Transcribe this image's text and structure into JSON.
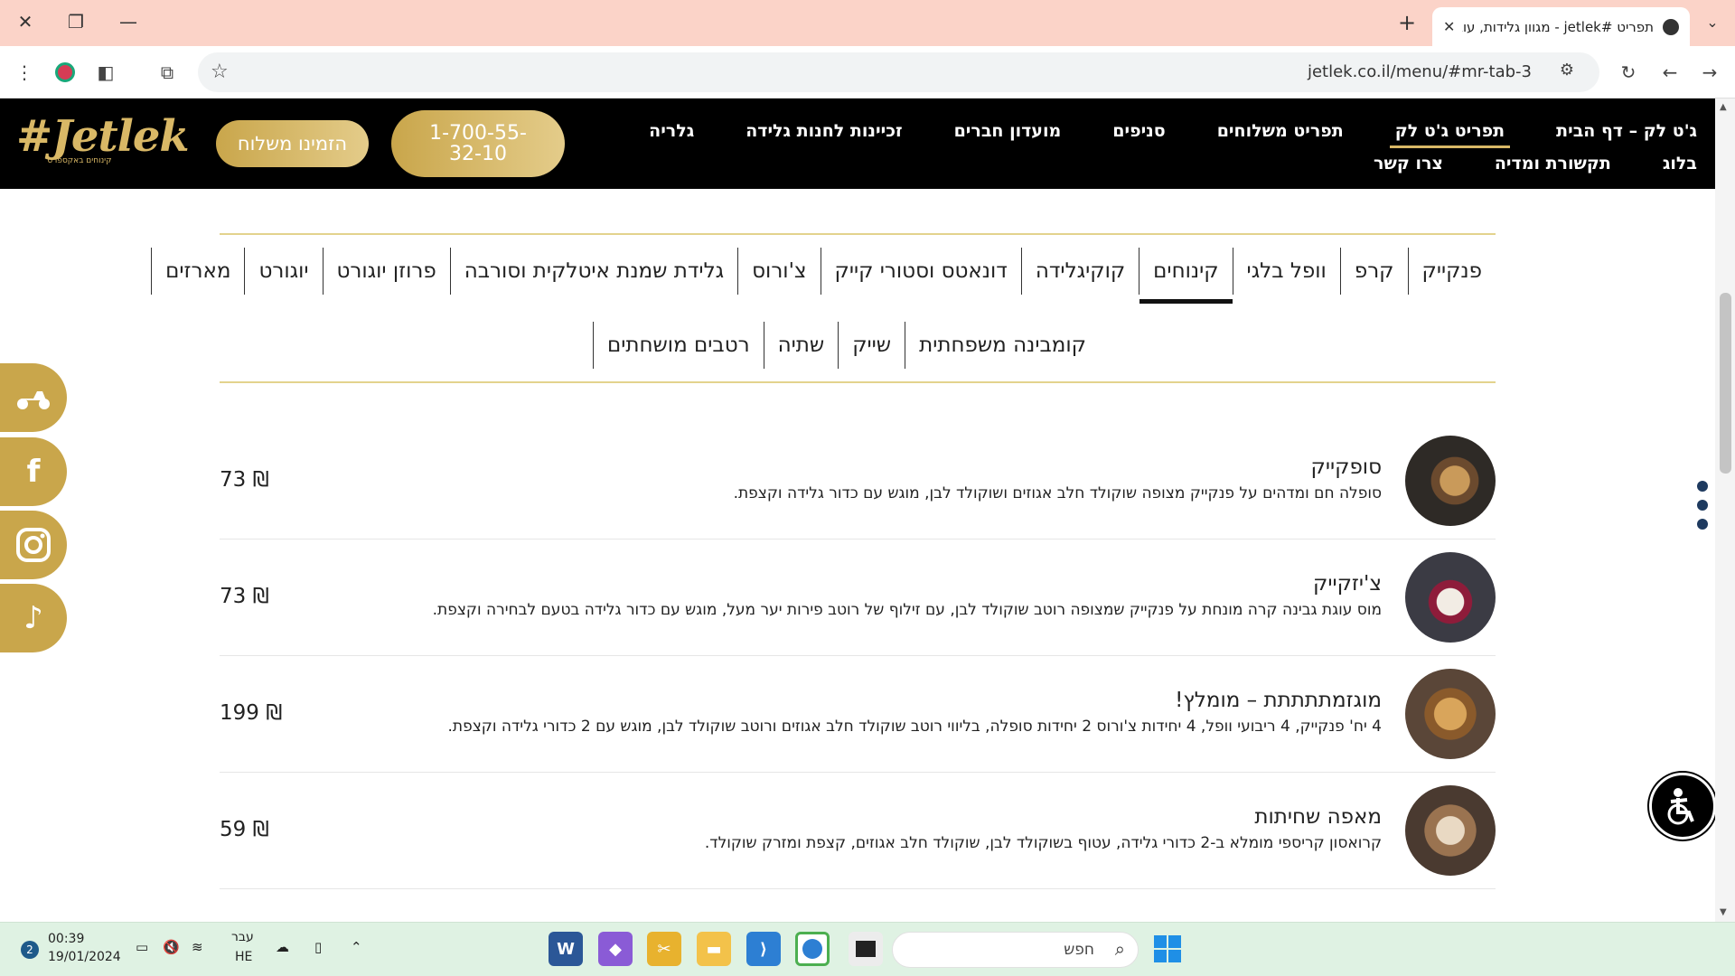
{
  "browser": {
    "tab_title": "תפריט #jetlek - מגוון גלידות, עוגות",
    "url": "jetlek.co.il/menu/#mr-tab-3"
  },
  "header": {
    "logo_text": "#Jetlek",
    "logo_sub": "קינוחים באקספרס",
    "order_button": "הזמינו משלוח",
    "phone_button": "1-700-55-32-10",
    "nav_row1": [
      "ג'ט לק – דף הבית",
      "תפריט ג'ט לק",
      "תפריט משלוחים",
      "סניפים",
      "מועדון חברים",
      "זכיינות לחנות גלידה",
      "גלריה"
    ],
    "nav_row2": [
      "בלוג",
      "תקשורת ומדיה",
      "צרו קשר"
    ]
  },
  "categories": {
    "row1": [
      "פנקייק",
      "קרפ",
      "וופל בלגי",
      "קינוחים",
      "קוקיגלידה",
      "דונאטס וסטורי קייק",
      "צ'ורוס",
      "גלידת שמנת איטלקית וסורבה",
      "פרוזן יוגורט",
      "יוגורט",
      "מארזים"
    ],
    "row2": [
      "קומבינה משפחתית",
      "שייק",
      "שתיה",
      "רטבים מושחתים"
    ],
    "active": "קינוחים"
  },
  "menu_items": [
    {
      "name": "סופקייק",
      "description": "סופלה חם ומדהים על פנקייק מצופה שוקולד חלב אגוזים ושוקולד לבן, מוגש עם כדור גלידה וקצפת.",
      "price": "73 ₪"
    },
    {
      "name": "צ'יזקייק",
      "description": "מוס עוגת גבינה קרה מונחת על פנקייק שמצופה רוטב שוקולד לבן, עם זילוף של רוטב פירות יער מעל, מוגש עם כדור גלידה בטעם לבחירה וקצפת.",
      "price": "73 ₪"
    },
    {
      "name": "מוגזמתתתתת – מומלץ!",
      "description": "4 יח' פנקייק, 4 ריבועי וופל, 4 יחידות צ'ורוס 2 יחידות סופלה, בליווי רוטב שוקולד חלב אגוזים ורוטב שוקולד לבן, מוגש עם 2 כדורי גלידה וקצפת.",
      "price": "199 ₪"
    },
    {
      "name": "מאפה שחיתות",
      "description": "קרואסון קריספי מומלא ב-2 כדורי גלידה, עטוף בשוקולד לבן, שוקולד חלב אגוזים, קצפת ומזרק שוקולד.",
      "price": "59 ₪"
    }
  ],
  "taskbar": {
    "search_placeholder": "חפש",
    "time": "00:39",
    "date": "19/01/2024",
    "lang_top": "עבר",
    "lang_bottom": "HE",
    "notif_count": "2"
  },
  "colors": {
    "gold": "#c9a64b",
    "header_bg": "#000000",
    "titlebar": "#fbd3c8",
    "taskbar": "#dff2e3"
  }
}
